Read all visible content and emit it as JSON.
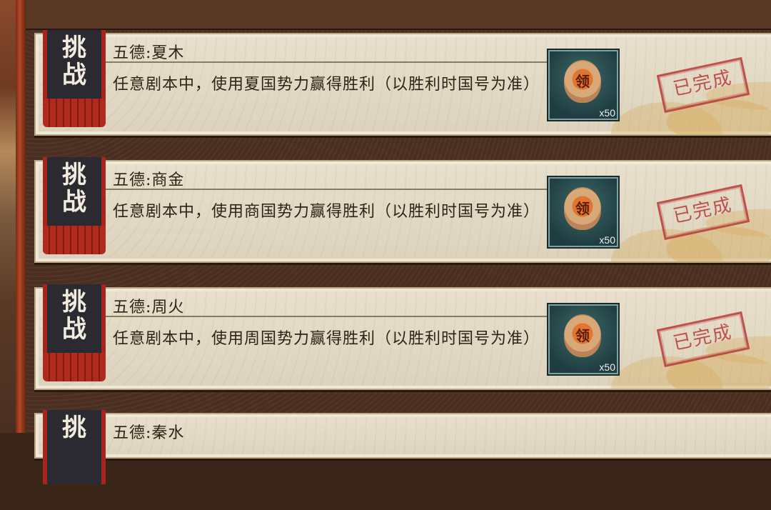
{
  "colors": {
    "banner_red": "#a4261c",
    "stamp_red": "#b83a3a",
    "card_bg": "#e8e0cd",
    "text": "#2d2418"
  },
  "tasks": [
    {
      "banner": [
        "挑",
        "战"
      ],
      "title": "五德:夏木",
      "description": "任意剧本中，使用夏国势力赢得胜利（以胜利时国号为准）",
      "reward_icon": "token-icon",
      "reward_char": "领",
      "reward_qty": "x50",
      "status": "已完成"
    },
    {
      "banner": [
        "挑",
        "战"
      ],
      "title": "五德:商金",
      "description": "任意剧本中，使用商国势力赢得胜利（以胜利时国号为准）",
      "reward_icon": "token-icon",
      "reward_char": "领",
      "reward_qty": "x50",
      "status": "已完成"
    },
    {
      "banner": [
        "挑",
        "战"
      ],
      "title": "五德:周火",
      "description": "任意剧本中，使用周国势力赢得胜利（以胜利时国号为准）",
      "reward_icon": "token-icon",
      "reward_char": "领",
      "reward_qty": "x50",
      "status": "已完成"
    },
    {
      "banner": [
        "挑"
      ],
      "title": "五德:秦水"
    }
  ]
}
